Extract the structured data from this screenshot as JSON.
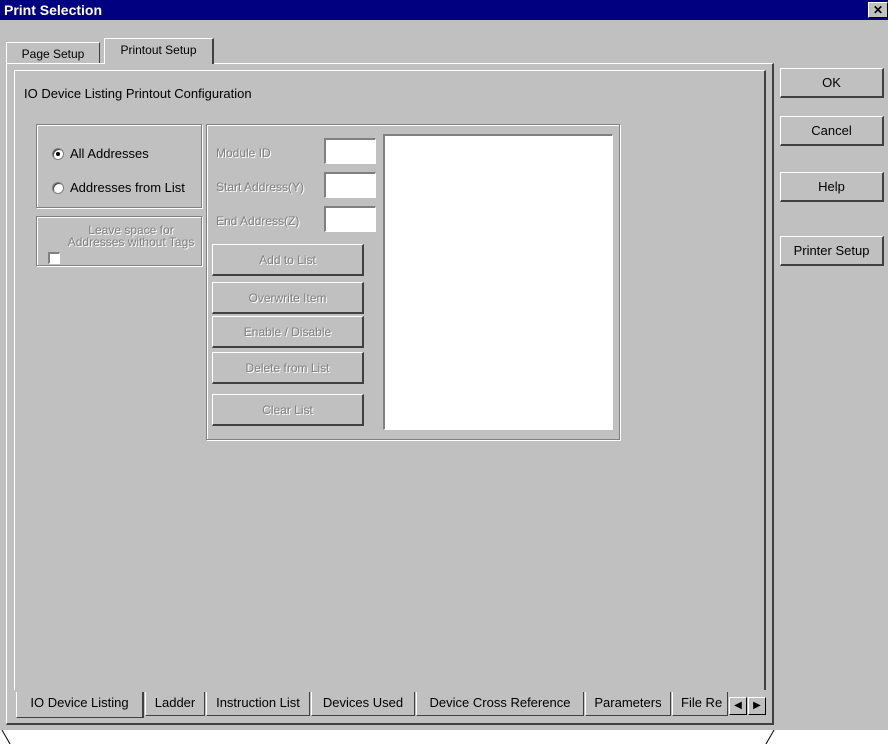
{
  "window": {
    "title": "Print Selection",
    "close_glyph": "✕"
  },
  "top_tabs": [
    "Page Setup",
    "Printout Setup"
  ],
  "section_title": "IO Device Listing Printout Configuration",
  "radio": {
    "all_addresses": "All Addresses",
    "addresses_from_list": "Addresses from List",
    "selected": "all_addresses"
  },
  "leave_space": "Leave space for Addresses without Tags",
  "fields": {
    "module_id": "Module ID",
    "start_address": "Start Address(Y)",
    "end_address": "End Address(Z)"
  },
  "actions": {
    "add_to_list": "Add to List",
    "overwrite_item": "Overwrite Item",
    "enable_disable": "Enable / Disable",
    "delete_from_list": "Delete from List",
    "clear_list": "Clear List"
  },
  "side_buttons": {
    "ok": "OK",
    "cancel": "Cancel",
    "help": "Help",
    "printer_setup": "Printer Setup"
  },
  "bottom_tabs": [
    "IO Device Listing",
    "Ladder",
    "Instruction List",
    "Devices Used",
    "Device Cross Reference",
    "Parameters",
    "File Re"
  ],
  "icons": {
    "scroll_left": "left-arrow-icon",
    "scroll_right": "right-arrow-icon"
  }
}
